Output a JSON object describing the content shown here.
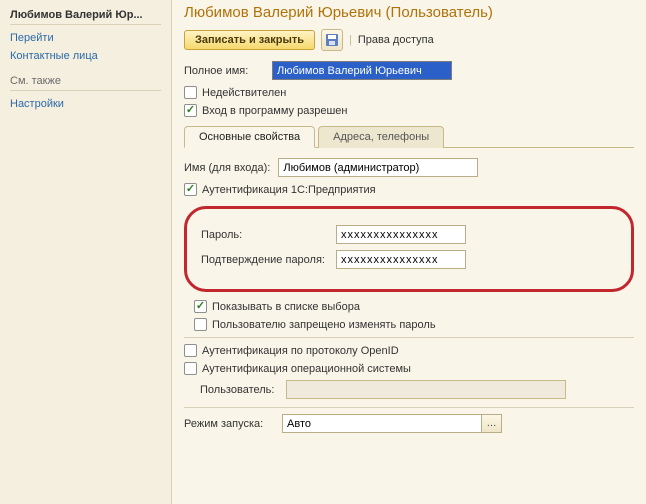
{
  "sidebar": {
    "title": "Любимов Валерий Юр...",
    "links": [
      "Перейти",
      "Контактные лица"
    ],
    "section_label": "См. также",
    "links2": [
      "Настройки"
    ]
  },
  "header": {
    "title": "Любимов Валерий Юрьевич (Пользователь)"
  },
  "toolbar": {
    "save_close": "Записать и закрыть",
    "access_rights": "Права доступа"
  },
  "fields": {
    "fullname_label": "Полное имя:",
    "fullname_value": "Любимов Валерий Юрьевич",
    "invalid_label": "Недействителен",
    "login_allowed_label": "Вход в программу разрешен"
  },
  "tabs": {
    "main": "Основные свойства",
    "addresses": "Адреса, телефоны"
  },
  "auth": {
    "username_label": "Имя (для входа):",
    "username_value": "Любимов (администратор)",
    "auth1c_label": "Аутентификация 1С:Предприятия",
    "password_label": "Пароль:",
    "password_value": "xxxxxxxxxxxxxxx",
    "confirm_label": "Подтверждение пароля:",
    "confirm_value": "xxxxxxxxxxxxxxx",
    "show_in_list": "Показывать в списке выбора",
    "cannot_change_pw": "Пользователю запрещено изменять пароль",
    "openid_label": "Аутентификация по протоколу OpenID",
    "os_auth_label": "Аутентификация операционной системы",
    "os_user_label": "Пользователь:",
    "launch_mode_label": "Режим запуска:",
    "launch_mode_value": "Авто"
  }
}
